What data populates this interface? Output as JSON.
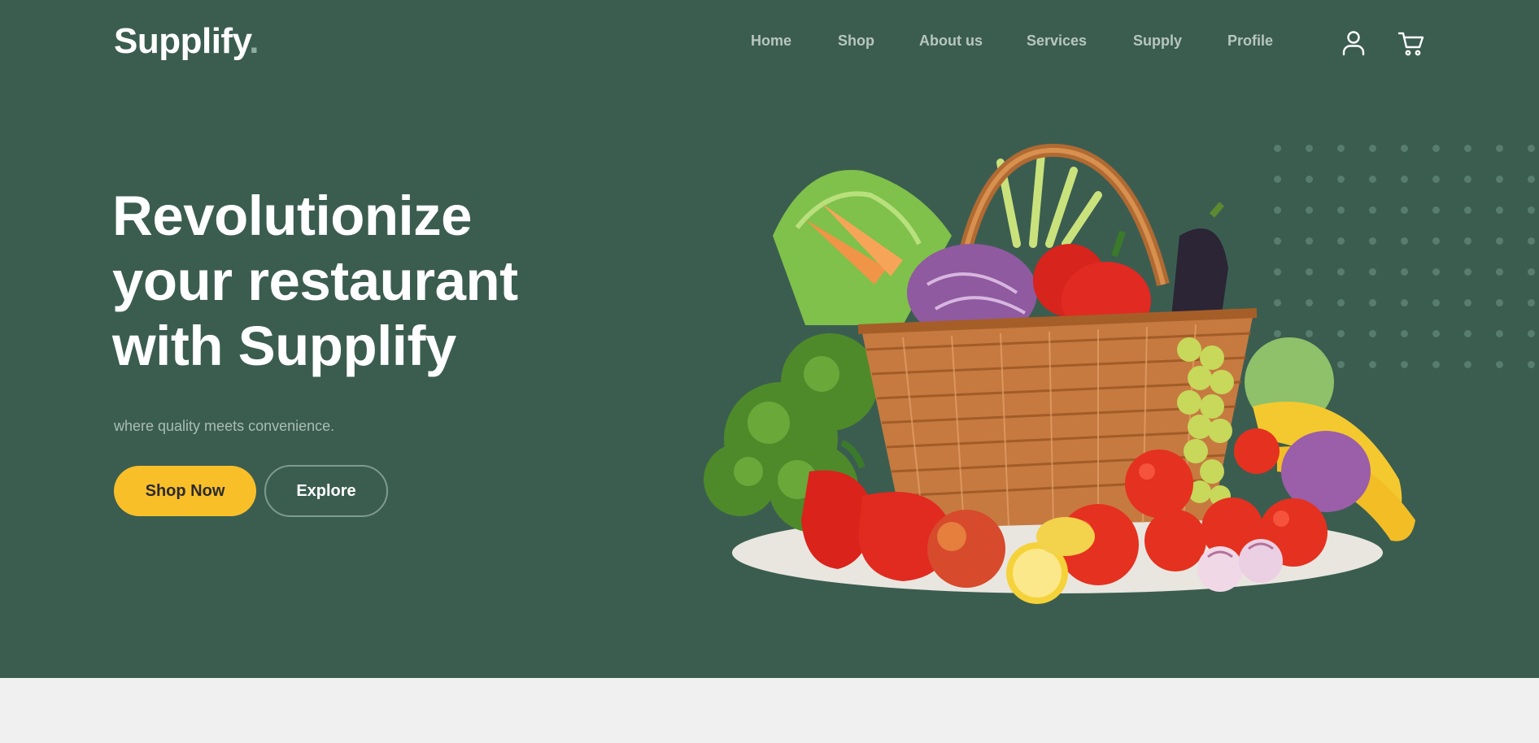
{
  "brand": {
    "name": "Supplify",
    "dot": "."
  },
  "nav": {
    "items": [
      {
        "label": "Home"
      },
      {
        "label": "Shop"
      },
      {
        "label": "About us"
      },
      {
        "label": "Services"
      },
      {
        "label": "Supply"
      },
      {
        "label": "Profile"
      }
    ],
    "icons": [
      "user-icon",
      "cart-icon"
    ]
  },
  "hero": {
    "headline_lines": [
      "Revolutionize",
      "your restaurant",
      "with Supplify"
    ],
    "subtitle": "where quality meets convenience.",
    "primary_button": "Shop Now",
    "secondary_button": "Explore",
    "image": "vegetable-basket-image"
  },
  "colors": {
    "hero_bg": "#3b5d50",
    "accent": "#f9bf29",
    "nav_text": "#b7c6bf",
    "section_bg": "#eff0ef"
  }
}
